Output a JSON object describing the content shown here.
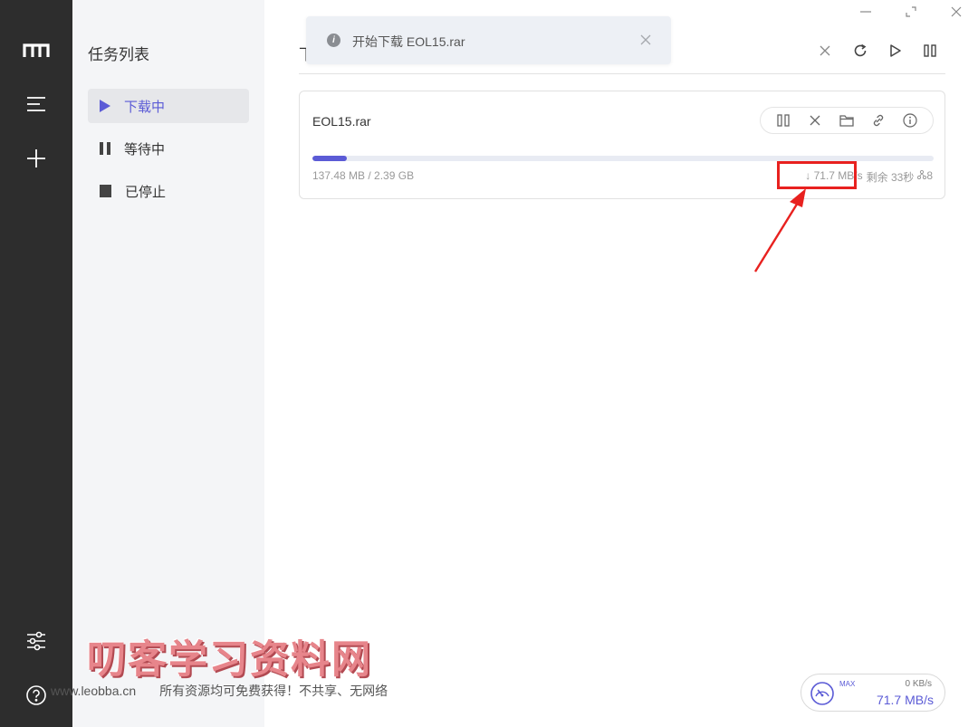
{
  "sidebar": {
    "title": "任务列表",
    "items": [
      {
        "label": "下载中",
        "icon": "play-icon"
      },
      {
        "label": "等待中",
        "icon": "pause-icon"
      },
      {
        "label": "已停止",
        "icon": "stop-icon"
      }
    ]
  },
  "toast": {
    "text": "开始下载 EOL15.rar",
    "icon": "info-icon"
  },
  "main": {
    "header_title": "下"
  },
  "task": {
    "file_name": "EOL15.rar",
    "size": "137.48 MB / 2.39 GB",
    "progress_fraction": 0.056,
    "speed": "↓ 71.7 MB/s",
    "remaining": "剩余 33秒",
    "connections": "8"
  },
  "watermark": {
    "title": "叨客学习资料网",
    "url": "www.leobba.cn",
    "tagline": "所有资源均可免费获得！不共享、无网络"
  },
  "speed_widget": {
    "max_label": "MAX",
    "upload": "0 KB/s",
    "download": "71.7 MB/s"
  },
  "colors": {
    "accent": "#5b5bd6",
    "rail": "#2d2d2d",
    "sidebar": "#f4f5f7",
    "highlight": "#e8211f"
  }
}
